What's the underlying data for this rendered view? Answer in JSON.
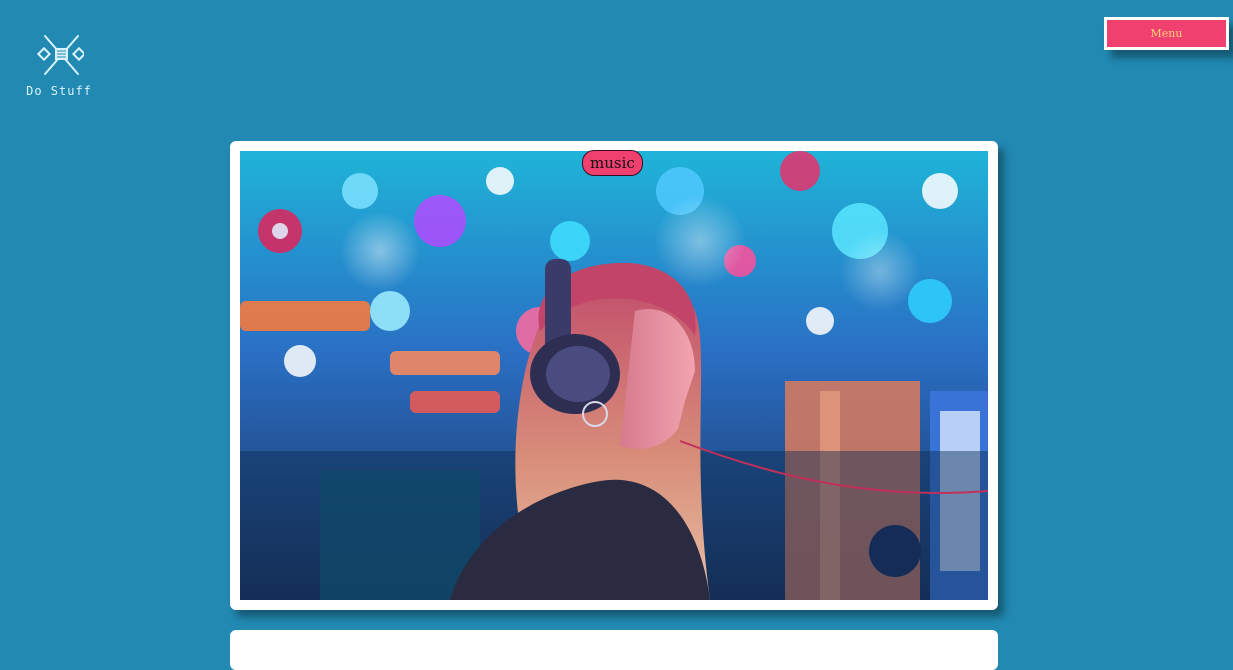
{
  "header": {
    "logo_text": "Do Stuff",
    "logo_icon": "crossed-tools-icon",
    "menu_label": "Menu"
  },
  "posts": [
    {
      "tag": "music",
      "image_alt": "Woman wearing headphones in a neon-lit record store"
    }
  ],
  "colors": {
    "background": "#2189b2",
    "accent": "#ef4070",
    "menu_text": "#ffd27a",
    "card": "#ffffff"
  }
}
